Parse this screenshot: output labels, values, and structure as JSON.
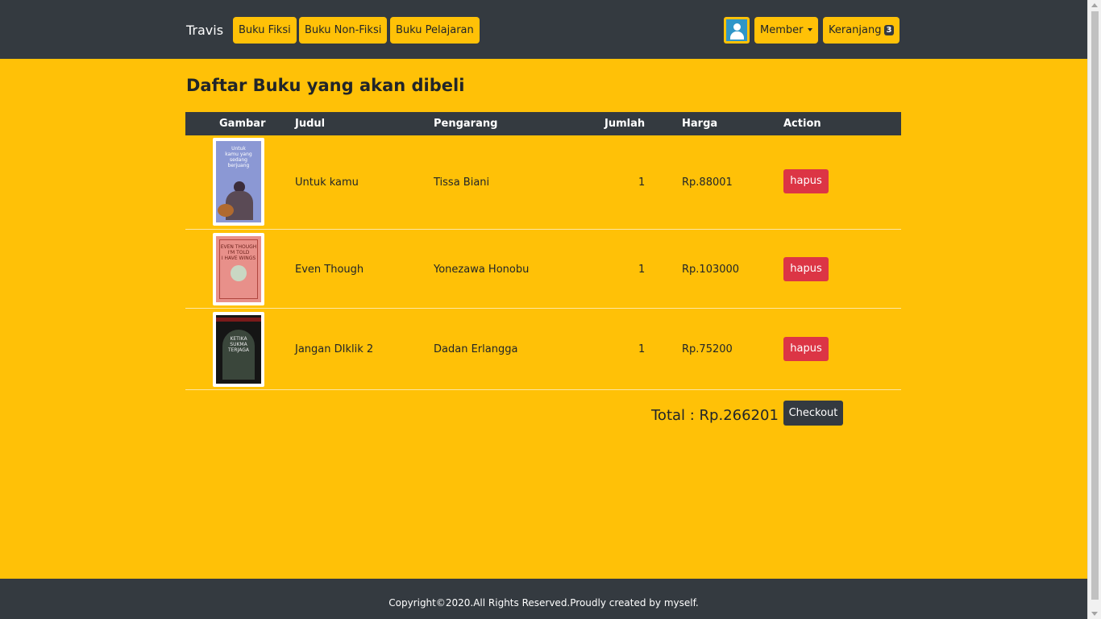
{
  "navbar": {
    "brand": "Travis",
    "links": [
      "Buku Fiksi",
      "Buku Non-Fiksi",
      "Buku Pelajaran"
    ],
    "avatar_icon": "user-icon",
    "member_label": "Member",
    "cart_label": "Keranjang",
    "cart_count": "3"
  },
  "page": {
    "title": "Daftar Buku yang akan dibeli"
  },
  "table": {
    "headers": {
      "gambar": "Gambar",
      "judul": "Judul",
      "pengarang": "Pengarang",
      "jumlah": "Jumlah",
      "harga": "Harga",
      "action": "Action"
    },
    "rows": [
      {
        "judul": "Untuk kamu",
        "pengarang": "Tissa Biani",
        "jumlah": "1",
        "harga": "Rp.88001",
        "action": "hapus"
      },
      {
        "judul": "Even Though",
        "pengarang": "Yonezawa Honobu",
        "jumlah": "1",
        "harga": "Rp.103000",
        "action": "hapus"
      },
      {
        "judul": "Jangan DIklik 2",
        "pengarang": "Dadan Erlangga",
        "jumlah": "1",
        "harga": "Rp.75200",
        "action": "hapus"
      }
    ]
  },
  "summary": {
    "total": "Total : Rp.266201",
    "checkout_label": "Checkout"
  },
  "footer": {
    "text": "Copyright©2020.All Rights Reserved.Proudly created by myself."
  },
  "colors": {
    "background": "#ffc107",
    "dark": "#343a40",
    "danger": "#dc3545"
  }
}
